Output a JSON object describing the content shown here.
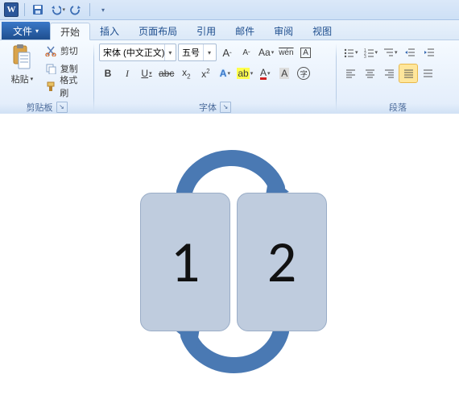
{
  "qat": {
    "app": "W",
    "save": "💾",
    "undo": "↶",
    "redo": "↷"
  },
  "tabs": {
    "file": "文件",
    "items": [
      "开始",
      "插入",
      "页面布局",
      "引用",
      "邮件",
      "审阅",
      "视图"
    ],
    "active_index": 0
  },
  "clipboard": {
    "paste": "粘贴",
    "cut": "剪切",
    "copy": "复制",
    "format_painter": "格式刷",
    "group_label": "剪贴板"
  },
  "font": {
    "name": "宋体 (中文正文)",
    "size": "五号",
    "grow": "A",
    "shrink": "A",
    "change_case": "Aa",
    "phonetic": "变",
    "char_border": "A",
    "clear": "A",
    "bold": "B",
    "italic": "I",
    "underline": "U",
    "strike": "abc",
    "sub": "x₂",
    "sup": "x²",
    "text_effects": "A",
    "highlight": "ab",
    "font_color": "A",
    "shading": "A",
    "enclose": "字",
    "group_label": "字体"
  },
  "paragraph": {
    "group_label": "段落"
  },
  "diagram": {
    "left": "1",
    "right": "2"
  }
}
